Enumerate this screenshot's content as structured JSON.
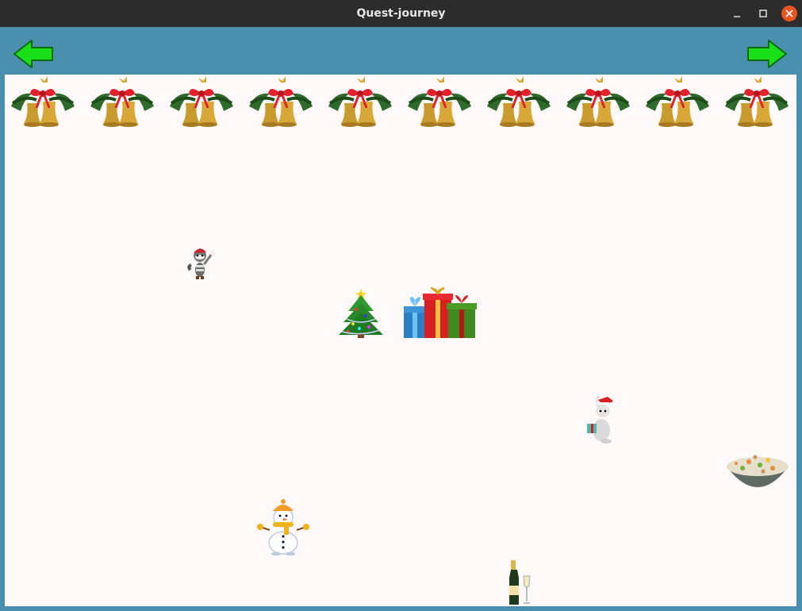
{
  "window": {
    "title": "Quest-journey"
  },
  "toolbar": {
    "back_icon": "green-left-arrow-icon",
    "forward_icon": "green-right-arrow-icon"
  },
  "game": {
    "background": "#fffaf9",
    "border_color": "#4b8fae",
    "decorations": [
      "christmas-bells",
      "christmas-bells",
      "christmas-bells",
      "christmas-bells",
      "christmas-bells",
      "christmas-bells",
      "christmas-bells",
      "christmas-bells",
      "christmas-bells",
      "christmas-bells"
    ],
    "objects": [
      "raccoon-character",
      "christmas-tree",
      "gift-boxes",
      "bunny-character",
      "salad-bowl",
      "snowman",
      "champagne-bottle"
    ]
  }
}
